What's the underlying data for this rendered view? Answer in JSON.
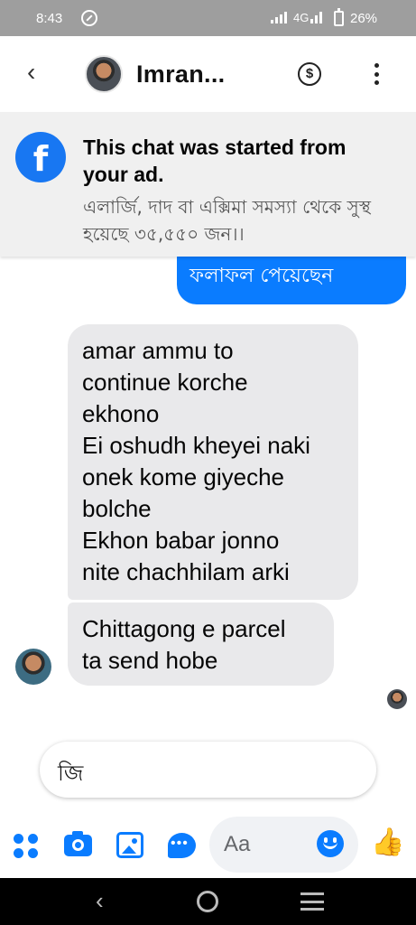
{
  "status_bar": {
    "time": "8:43",
    "network": "4G",
    "battery": "26%"
  },
  "header": {
    "contact_name": "Imran...",
    "payment_symbol": "$"
  },
  "ad_banner": {
    "logo_letter": "f",
    "title": "This chat was started from your ad.",
    "subtitle": "এলার্জি, দাদ বা এক্সিমা সমস্যা থেকে সুস্থ হয়েছে ৩৫,৫৫০ জন।।"
  },
  "messages": {
    "outgoing_partial": "ফলাফল পেয়েছেন",
    "incoming_1": [
      "amar ammu to",
      "continue korche",
      "ekhono",
      "Ei oshudh kheyei naki",
      "onek kome giyeche",
      "bolche",
      "Ekhon babar jonno",
      "nite chachhilam arki"
    ],
    "incoming_2": [
      "Chittagong e parcel",
      "ta send hobe"
    ]
  },
  "quick_reply": "জি",
  "composer": {
    "placeholder": "Aa"
  },
  "colors": {
    "accent": "#0a7cff",
    "facebook_blue": "#1877f2",
    "incoming_bubble": "#e9e9eb"
  }
}
